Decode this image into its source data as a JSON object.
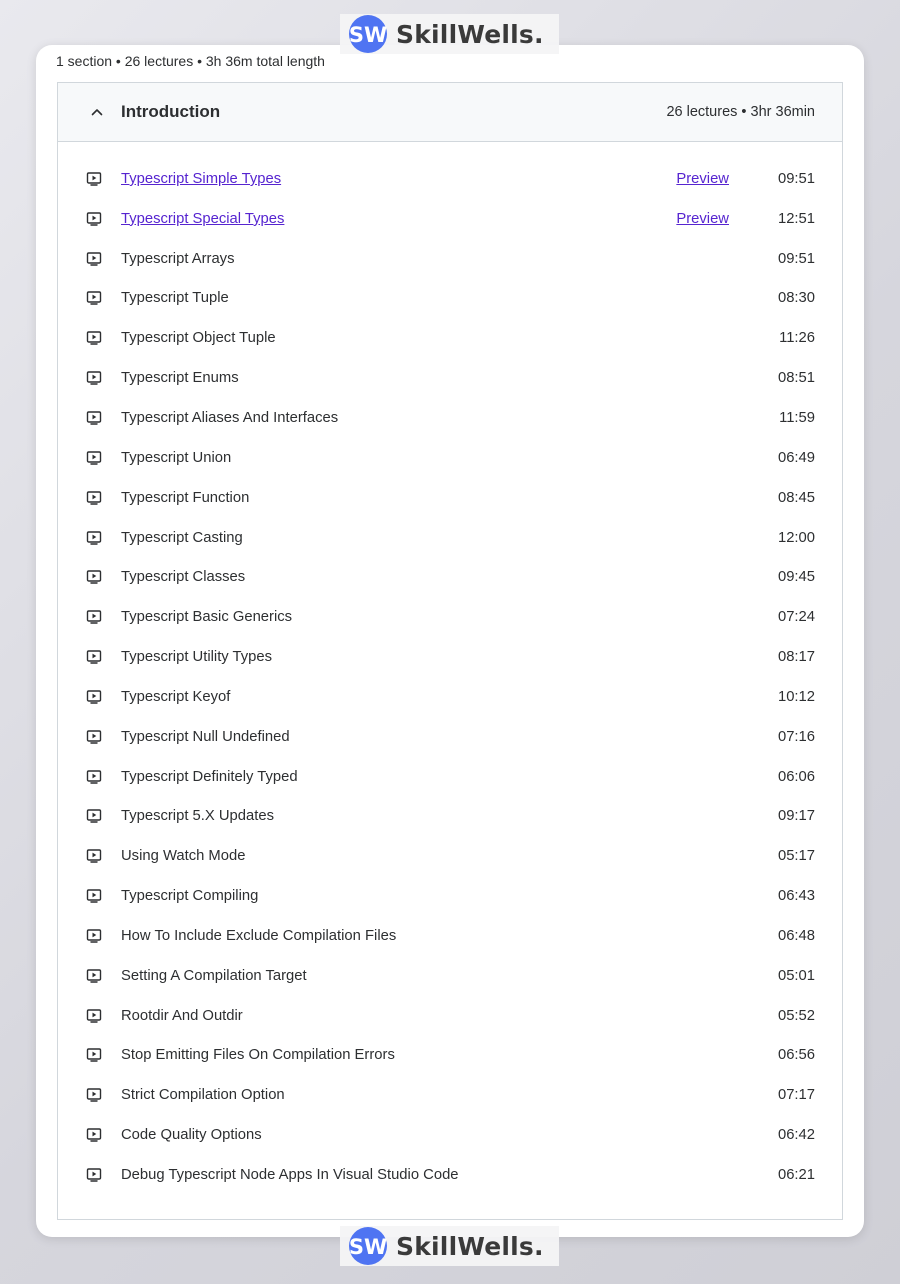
{
  "watermark": {
    "brand": "SkillWells.",
    "initials": "SW",
    "color": "#4f74f2"
  },
  "summary": "1 section • 26 lectures • 3h 36m total length",
  "section": {
    "title": "Introduction",
    "meta": "26 lectures • 3hr 36min",
    "expanded": true
  },
  "colors": {
    "link": "#5624d0",
    "text": "#2d2f31",
    "border": "#d1d7dc",
    "header_bg": "#f7f9fa"
  },
  "lectures": [
    {
      "title": "Typescript Simple Types",
      "duration": "09:51",
      "preview": "Preview"
    },
    {
      "title": "Typescript Special Types",
      "duration": "12:51",
      "preview": "Preview"
    },
    {
      "title": "Typescript Arrays",
      "duration": "09:51"
    },
    {
      "title": "Typescript Tuple",
      "duration": "08:30"
    },
    {
      "title": "Typescript Object Tuple",
      "duration": "11:26"
    },
    {
      "title": "Typescript Enums",
      "duration": "08:51"
    },
    {
      "title": "Typescript Aliases And Interfaces",
      "duration": "11:59"
    },
    {
      "title": "Typescript Union",
      "duration": "06:49"
    },
    {
      "title": "Typescript Function",
      "duration": "08:45"
    },
    {
      "title": "Typescript Casting",
      "duration": "12:00"
    },
    {
      "title": "Typescript Classes",
      "duration": "09:45"
    },
    {
      "title": "Typescript Basic Generics",
      "duration": "07:24"
    },
    {
      "title": "Typescript Utility Types",
      "duration": "08:17"
    },
    {
      "title": "Typescript Keyof",
      "duration": "10:12"
    },
    {
      "title": "Typescript Null Undefined",
      "duration": "07:16"
    },
    {
      "title": "Typescript Definitely Typed",
      "duration": "06:06"
    },
    {
      "title": "Typescript 5.X Updates",
      "duration": "09:17"
    },
    {
      "title": "Using Watch Mode",
      "duration": "05:17"
    },
    {
      "title": "Typescript Compiling",
      "duration": "06:43"
    },
    {
      "title": "How To Include Exclude Compilation Files",
      "duration": "06:48"
    },
    {
      "title": "Setting A Compilation Target",
      "duration": "05:01"
    },
    {
      "title": "Rootdir And Outdir",
      "duration": "05:52"
    },
    {
      "title": "Stop Emitting Files On Compilation Errors",
      "duration": "06:56"
    },
    {
      "title": "Strict Compilation Option",
      "duration": "07:17"
    },
    {
      "title": "Code Quality Options",
      "duration": "06:42"
    },
    {
      "title": "Debug Typescript Node Apps In Visual Studio Code",
      "duration": "06:21"
    }
  ]
}
